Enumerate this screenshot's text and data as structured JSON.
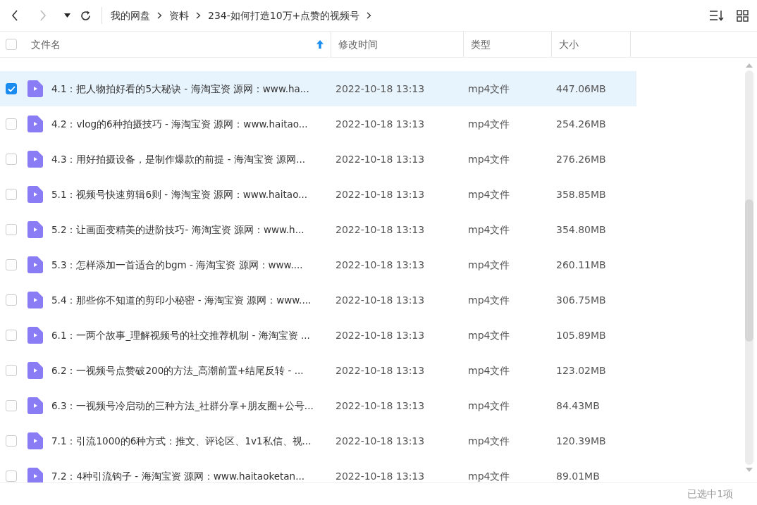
{
  "select_all": {
    "checked": false
  },
  "breadcrumb": [
    {
      "label": "我的网盘"
    },
    {
      "label": "资料"
    },
    {
      "label": "234-如何打造10万+点赞的视频号"
    }
  ],
  "columns": [
    {
      "label": "文件名",
      "sorted": true
    },
    {
      "label": "修改时间",
      "sorted": false
    },
    {
      "label": "类型",
      "sorted": false
    },
    {
      "label": "大小",
      "sorted": false
    }
  ],
  "rows": [
    {
      "name": "4.1：把人物拍好看的5大秘诀 - 海淘宝资 源网：www.ha...",
      "modified": "2022-10-18 13:13",
      "type": "mp4文件",
      "size": "447.06MB",
      "selected": true
    },
    {
      "name": "4.2：vlog的6种拍摄技巧 - 海淘宝资 源网：www.haitao...",
      "modified": "2022-10-18 13:13",
      "type": "mp4文件",
      "size": "254.26MB",
      "selected": false
    },
    {
      "name": "4.3：用好拍摄设备，是制作爆款的前提 - 海淘宝资 源网...",
      "modified": "2022-10-18 13:13",
      "type": "mp4文件",
      "size": "276.26MB",
      "selected": false
    },
    {
      "name": "5.1：视频号快速剪辑6则 - 海淘宝资 源网：www.haitao...",
      "modified": "2022-10-18 13:13",
      "type": "mp4文件",
      "size": "358.85MB",
      "selected": false
    },
    {
      "name": "5.2：让画面变精美的进阶技巧- 海淘宝资 源网：www.h...",
      "modified": "2022-10-18 13:13",
      "type": "mp4文件",
      "size": "354.80MB",
      "selected": false
    },
    {
      "name": "5.3：怎样添加一首适合的bgm - 海淘宝资 源网：www....",
      "modified": "2022-10-18 13:13",
      "type": "mp4文件",
      "size": "260.11MB",
      "selected": false
    },
    {
      "name": "5.4：那些你不知道的剪印小秘密 - 海淘宝资 源网：www....",
      "modified": "2022-10-18 13:13",
      "type": "mp4文件",
      "size": "306.75MB",
      "selected": false
    },
    {
      "name": "6.1：一两个故事_理解视频号的社交推荐机制 - 海淘宝资 ...",
      "modified": "2022-10-18 13:13",
      "type": "mp4文件",
      "size": "105.89MB",
      "selected": false
    },
    {
      "name": "6.2：一视频号点赞破200的方法_高潮前置+结尾反转 - ...",
      "modified": "2022-10-18 13:13",
      "type": "mp4文件",
      "size": "123.02MB",
      "selected": false
    },
    {
      "name": "6.3：一视频号冷启动的三种方法_社群分享+朋友圈+公号...",
      "modified": "2022-10-18 13:13",
      "type": "mp4文件",
      "size": "84.43MB",
      "selected": false
    },
    {
      "name": "7.1：引流1000的6种方式：推文、评论区、1v1私信、视...",
      "modified": "2022-10-18 13:13",
      "type": "mp4文件",
      "size": "120.39MB",
      "selected": false
    },
    {
      "name": "7.2：4种引流钩子 - 海淘宝资 源网：www.haitaoketan...",
      "modified": "2022-10-18 13:13",
      "type": "mp4文件",
      "size": "89.01MB",
      "selected": false
    }
  ],
  "status_bar": "已选中1项"
}
